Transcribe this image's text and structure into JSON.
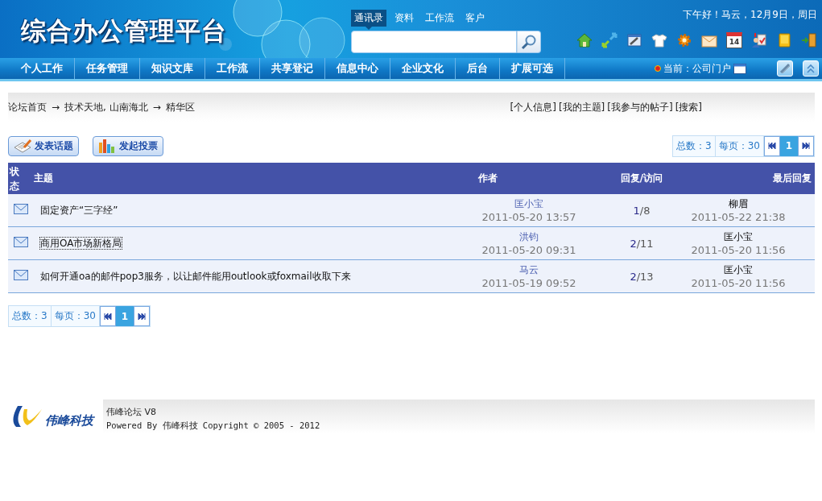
{
  "header": {
    "title": "综合办公管理平台",
    "tabs": [
      {
        "label": "通讯录",
        "selected": true
      },
      {
        "label": "资料",
        "selected": false
      },
      {
        "label": "工作流",
        "selected": false
      },
      {
        "label": "客户",
        "selected": false
      }
    ],
    "greeting": "下午好！马云，12月9日，周日",
    "toolbar": [
      {
        "kind": "home"
      },
      {
        "kind": "arrows"
      },
      {
        "kind": "tools"
      },
      {
        "kind": "shirt"
      },
      {
        "kind": "gear"
      },
      {
        "kind": "mail"
      },
      {
        "kind": "calendar",
        "label": "14"
      },
      {
        "kind": "user"
      },
      {
        "kind": "book"
      },
      {
        "kind": "exit"
      }
    ]
  },
  "nav": {
    "items": [
      {
        "label": "个人工作"
      },
      {
        "label": "任务管理"
      },
      {
        "label": "知识文库"
      },
      {
        "label": "工作流"
      },
      {
        "label": "共享登记"
      },
      {
        "label": "信息中心"
      },
      {
        "label": "企业文化"
      },
      {
        "label": "后台"
      },
      {
        "label": "扩展可选"
      }
    ],
    "current": "当前：公司门户"
  },
  "forum": {
    "breadcrumb": [
      {
        "label": "论坛首页"
      },
      {
        "label": "技术天地, 山南海北"
      },
      {
        "label": "精华区"
      }
    ],
    "separator": "→",
    "links": [
      "[个人信息]",
      "[我的主题]",
      "[我参与的帖子]",
      "[搜索]"
    ],
    "actions": [
      {
        "kind": "post",
        "label": "发表话题"
      },
      {
        "kind": "poll",
        "label": "发起投票"
      }
    ],
    "pager_top": {
      "total": "总数：3",
      "per_page": "每页：30",
      "pages": [
        {
          "label": "1",
          "selected": true
        }
      ]
    },
    "table": {
      "columns": [
        "状态",
        "主题",
        "作者",
        "回复/访问",
        "最后回复"
      ],
      "rows": [
        {
          "title": "固定资产“三字经”",
          "focused": false,
          "author": "匡小宝",
          "posted": "2011-05-20 13:57",
          "replies": "1",
          "visits": "/8",
          "last_by": "柳眉",
          "last_time": "2011-05-22 21:38"
        },
        {
          "title": "商用OA市场新格局",
          "focused": true,
          "author": "洪钧",
          "posted": "2011-05-20 09:31",
          "replies": "2",
          "visits": "/11",
          "last_by": "匡小宝",
          "last_time": "2011-05-20 11:56"
        },
        {
          "title": "如何开通oa的邮件pop3服务，以让邮件能用outlook或foxmail收取下来",
          "focused": false,
          "author": "马云",
          "posted": "2011-05-19 09:52",
          "replies": "2",
          "visits": "/13",
          "last_by": "匡小宝",
          "last_time": "2011-05-20 11:56"
        }
      ]
    },
    "pager_bottom": {
      "total": "总数：3",
      "per_page": "每页：30",
      "pages": [
        {
          "label": "1",
          "selected": true
        }
      ]
    }
  },
  "footer": {
    "logo_text": "伟峰科技",
    "name": "伟峰论坛 V8",
    "copyright": "Powered By 伟峰科技 Copyright © 2005 - 2012"
  }
}
